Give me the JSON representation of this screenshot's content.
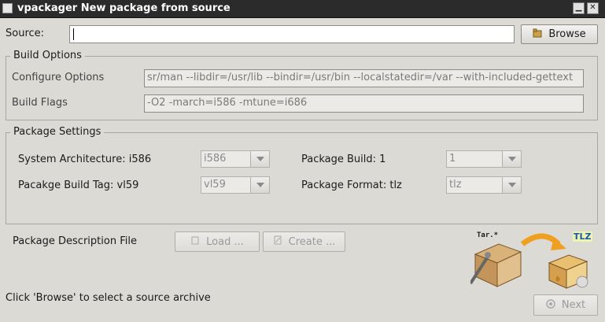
{
  "window": {
    "title": "vpackager New package from source",
    "minimize": "▁",
    "close": "✕"
  },
  "source": {
    "label": "Source:",
    "value": "",
    "browse_label": "Browse"
  },
  "build_options": {
    "title": "Build Options",
    "configure_label": "Configure Options",
    "configure_value": "sr/man --libdir=/usr/lib --bindir=/usr/bin --localstatedir=/var --with-included-gettext",
    "flags_label": "Build Flags",
    "flags_value": "-O2 -march=i586 -mtune=i686"
  },
  "package_settings": {
    "title": "Package Settings",
    "arch_label": "System Architecture: i586",
    "arch_value": "i586",
    "tag_label": "Pacakge Build Tag: vl59",
    "tag_value": "vl59",
    "build_label": "Package Build: 1",
    "build_value": "1",
    "format_label": "Package Format: tlz",
    "format_value": "tlz"
  },
  "description": {
    "label": "Package Description File",
    "load_label": "Load ...",
    "create_label": "Create ..."
  },
  "graphic": {
    "tar_label": "Tar.*",
    "tlz_label": "TLZ"
  },
  "status": {
    "text": "Click 'Browse' to select a source archive"
  },
  "next": {
    "label": "Next"
  }
}
